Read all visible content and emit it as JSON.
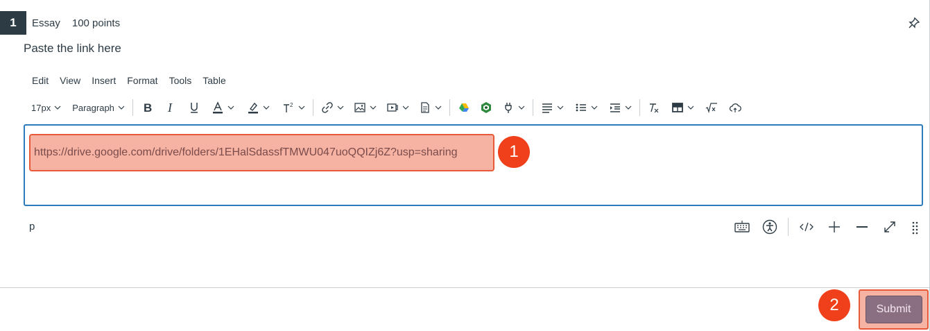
{
  "question": {
    "number": "1",
    "type": "Essay",
    "points": "100 points",
    "prompt": "Paste the link here"
  },
  "menubar": {
    "items": [
      "Edit",
      "View",
      "Insert",
      "Format",
      "Tools",
      "Table"
    ]
  },
  "toolbar": {
    "font_size": "17px",
    "block_format": "Paragraph"
  },
  "editor": {
    "content": "https://drive.google.com/drive/folders/1EHalSdassfTMWU047uoQQIZj6Z?usp=sharing"
  },
  "statusbar": {
    "path": "p"
  },
  "annotations": {
    "step1": "1",
    "step2": "2"
  },
  "actions": {
    "submit_label": "Submit"
  },
  "colors": {
    "accent": "#2b7abc",
    "highlight": "#f6b3a3",
    "badge": "#f0401b",
    "submit": "#8a6f83"
  }
}
